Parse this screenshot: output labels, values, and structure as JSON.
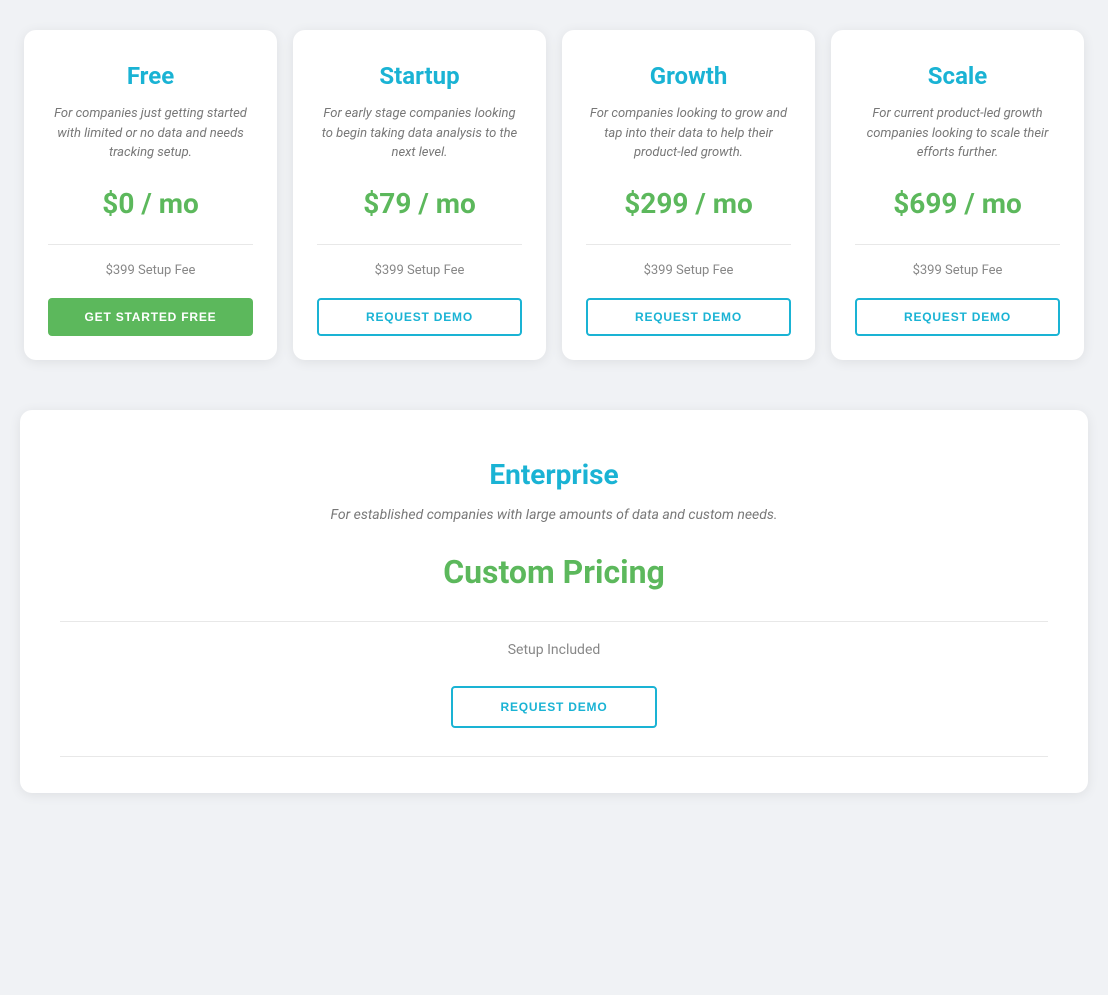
{
  "plans": [
    {
      "id": "free",
      "name": "Free",
      "description": "For companies just getting started with limited or no data and needs tracking setup.",
      "price": "$0 / mo",
      "setup_fee": "$399 Setup Fee",
      "cta_label": "GET STARTED FREE",
      "cta_type": "primary"
    },
    {
      "id": "startup",
      "name": "Startup",
      "description": "For early stage companies looking to begin taking data analysis to the next level.",
      "price": "$79 / mo",
      "setup_fee": "$399 Setup Fee",
      "cta_label": "REQUEST DEMO",
      "cta_type": "outline"
    },
    {
      "id": "growth",
      "name": "Growth",
      "description": "For companies looking to grow and tap into their data to help their product-led growth.",
      "price": "$299 / mo",
      "setup_fee": "$399 Setup Fee",
      "cta_label": "REQUEST DEMO",
      "cta_type": "outline"
    },
    {
      "id": "scale",
      "name": "Scale",
      "description": "For current product-led growth companies looking to scale their efforts further.",
      "price": "$699 / mo",
      "setup_fee": "$399 Setup Fee",
      "cta_label": "REQUEST DEMO",
      "cta_type": "outline"
    }
  ],
  "enterprise": {
    "name": "Enterprise",
    "description": "For established companies with large amounts of data and custom needs.",
    "price": "Custom Pricing",
    "setup_fee": "Setup Included",
    "cta_label": "REQUEST DEMO"
  },
  "colors": {
    "plan_name": "#1ab3d4",
    "price": "#5cb85c",
    "description": "#777777",
    "setup_fee": "#888888",
    "btn_primary_bg": "#5cb85c",
    "btn_outline_border": "#1ab3d4"
  }
}
